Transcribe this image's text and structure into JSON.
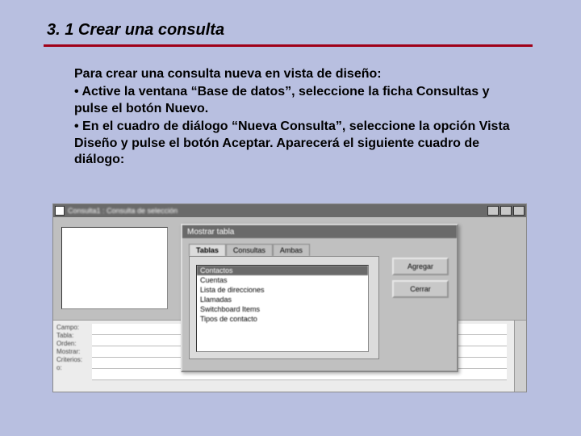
{
  "title": "3. 1 Crear una consulta",
  "intro": "Para crear una consulta nueva en vista de diseño:",
  "bullets": [
    "• Active la ventana “Base de datos”, seleccione la ficha Consultas y pulse el botón Nuevo.",
    "• En el cuadro de diálogo “Nueva Consulta”, seleccione la opción Vista Diseño y pulse el botón Aceptar. Aparecerá el siguiente cuadro de diálogo:"
  ],
  "bg_window": {
    "title": "Consulta1 : Consulta de selección"
  },
  "grid_labels": [
    "Campo:",
    "Tabla:",
    "Orden:",
    "Mostrar:",
    "Criterios:",
    "o:"
  ],
  "dialog": {
    "title": "Mostrar tabla",
    "tabs": [
      "Tablas",
      "Consultas",
      "Ambas"
    ],
    "active_tab": 0,
    "items": [
      "Contactos",
      "Cuentas",
      "Lista de direcciones",
      "Llamadas",
      "Switchboard Items",
      "Tipos de contacto"
    ],
    "selected_item": 0,
    "buttons": {
      "add": "Agregar",
      "close": "Cerrar"
    }
  }
}
